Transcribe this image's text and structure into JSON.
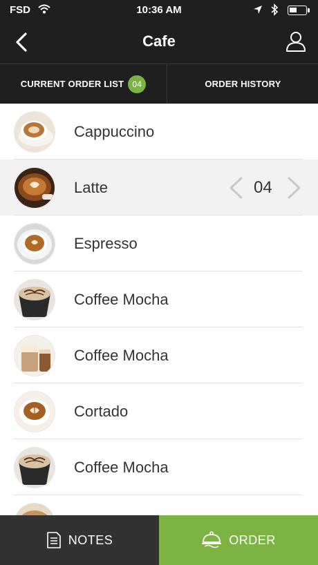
{
  "status_bar": {
    "carrier": "FSD",
    "time": "10:36 AM"
  },
  "nav": {
    "title": "Cafe"
  },
  "tabs": {
    "current": {
      "label": "CURRENT ORDER LIST",
      "count": "04"
    },
    "history": {
      "label": "ORDER HISTORY"
    }
  },
  "items": [
    {
      "name": "Cappuccino",
      "image": "cappuccino-photo"
    },
    {
      "name": "Latte",
      "image": "latte-photo",
      "selected": true,
      "quantity": "04"
    },
    {
      "name": "Espresso",
      "image": "espresso-photo"
    },
    {
      "name": "Coffee Mocha",
      "image": "mocha-photo"
    },
    {
      "name": "Coffee Mocha",
      "image": "iced-mocha-photo"
    },
    {
      "name": "Cortado",
      "image": "cortado-photo"
    },
    {
      "name": "Coffee Mocha",
      "image": "mocha-photo"
    }
  ],
  "footer": {
    "notes_label": "NOTES",
    "order_label": "ORDER"
  },
  "colors": {
    "bar": "#1f1f1f",
    "accent": "#7cb342",
    "notes_button": "#323232",
    "selected_row": "#f2f2f2"
  },
  "icons": [
    "wifi-icon",
    "location-arrow-icon",
    "bluetooth-icon",
    "battery-icon",
    "back-chevron-icon",
    "user-profile-icon",
    "chevron-left-icon",
    "chevron-right-icon",
    "notes-icon",
    "cloche-icon"
  ]
}
